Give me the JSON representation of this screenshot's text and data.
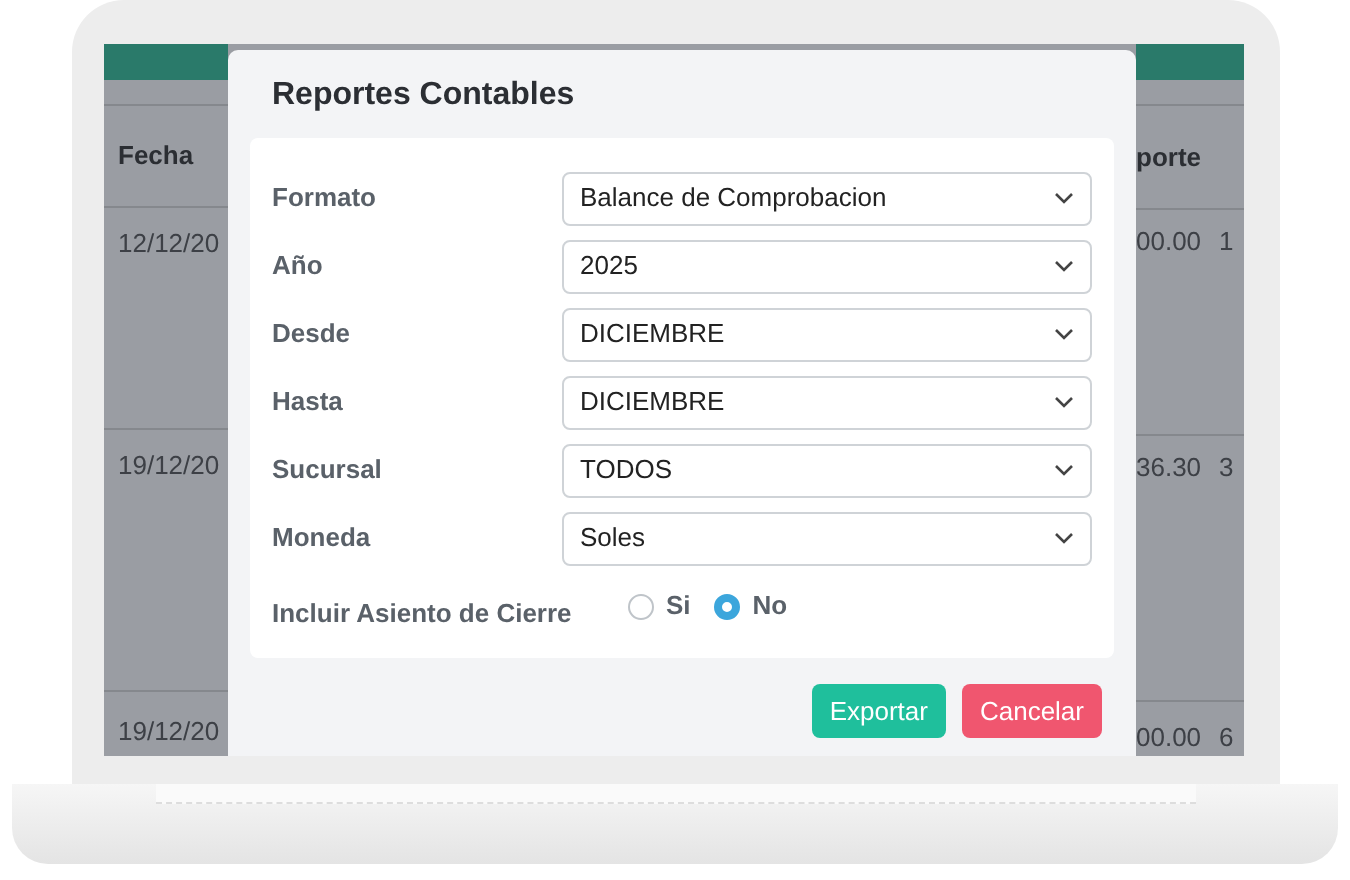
{
  "background_table": {
    "left_column": {
      "heading": "Fecha",
      "cells": [
        "12/12/20",
        "19/12/20",
        "19/12/20"
      ]
    },
    "right_columns": {
      "heading": "porte",
      "cells": [
        "00.00",
        "36.30",
        "00.00"
      ],
      "column_3_cells": [
        "1",
        "3",
        "6"
      ]
    }
  },
  "dialog": {
    "title": "Reportes Contables",
    "fields": [
      {
        "kind": "select",
        "label": "Formato",
        "value": "Balance de Comprobacion"
      },
      {
        "kind": "select",
        "label": "Año",
        "value": "2025"
      },
      {
        "kind": "select",
        "label": "Desde",
        "value": "DICIEMBRE"
      },
      {
        "kind": "select",
        "label": "Hasta",
        "value": "DICIEMBRE"
      },
      {
        "kind": "select",
        "label": "Sucursal",
        "value": "TODOS"
      },
      {
        "kind": "select",
        "label": "Moneda",
        "value": "Soles"
      },
      {
        "kind": "radio",
        "label": "Incluir Asiento de Cierre",
        "options": [
          {
            "label": "Si",
            "selected": false
          },
          {
            "label": "No",
            "selected": true
          }
        ]
      }
    ],
    "buttons": [
      {
        "kind": "primary",
        "label": "Exportar"
      },
      {
        "kind": "danger",
        "label": "Cancelar"
      }
    ]
  }
}
